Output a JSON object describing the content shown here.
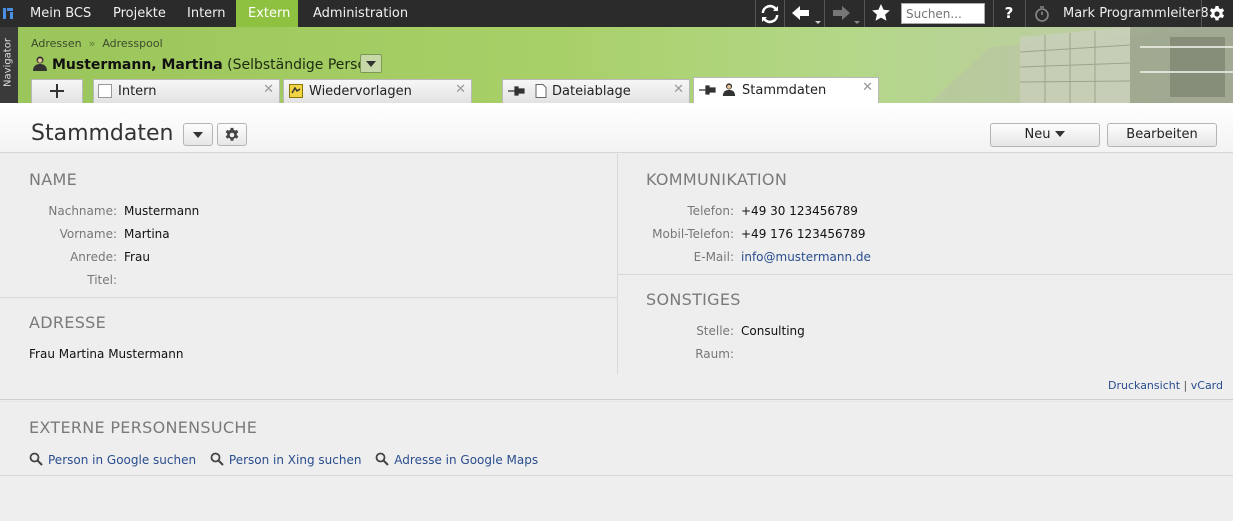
{
  "topnav": {
    "items": [
      "Mein BCS",
      "Projekte",
      "Intern",
      "Extern",
      "Administration"
    ],
    "active_index": 3,
    "search_placeholder": "Suchen...",
    "help_label": "?",
    "user_name": "Mark Programmleiter8"
  },
  "navigator_label": "Navigator",
  "breadcrumb": [
    "Adressen",
    "Adresspool"
  ],
  "person": {
    "name": "Mustermann, Martina",
    "type": "(Selbständige Person)"
  },
  "tabs": [
    {
      "label": "Intern"
    },
    {
      "label": "Wiedervorlagen"
    },
    {
      "label": "Dateiablage"
    },
    {
      "label": "Stammdaten"
    }
  ],
  "page": {
    "title": "Stammdaten",
    "new_label": "Neu",
    "edit_label": "Bearbeiten"
  },
  "name_section": {
    "title": "NAME",
    "rows": [
      {
        "label": "Nachname:",
        "value": "Mustermann"
      },
      {
        "label": "Vorname:",
        "value": "Martina"
      },
      {
        "label": "Anrede:",
        "value": "Frau"
      },
      {
        "label": "Titel:",
        "value": ""
      }
    ]
  },
  "address_section": {
    "title": "ADRESSE",
    "text": "Frau Martina Mustermann"
  },
  "communication_section": {
    "title": "KOMMUNIKATION",
    "rows": [
      {
        "label": "Telefon:",
        "value": "+49 30 123456789"
      },
      {
        "label": "Mobil-Telefon:",
        "value": "+49 176 123456789"
      },
      {
        "label": "E-Mail:",
        "value": "info@mustermann.de"
      }
    ]
  },
  "misc_section": {
    "title": "SONSTIGES",
    "rows": [
      {
        "label": "Stelle:",
        "value": "Consulting"
      },
      {
        "label": "Raum:",
        "value": ""
      }
    ]
  },
  "footer_links": {
    "print": "Druckansicht",
    "separator": "|",
    "vcard": "vCard"
  },
  "external_search": {
    "title": "EXTERNE PERSONENSUCHE",
    "links": [
      "Person in Google suchen",
      "Person in Xing suchen",
      "Adresse in Google Maps"
    ]
  },
  "colors": {
    "accent_green": "#8fc140",
    "link_blue": "#2a4d8e",
    "topbar": "#2b2b2b"
  }
}
